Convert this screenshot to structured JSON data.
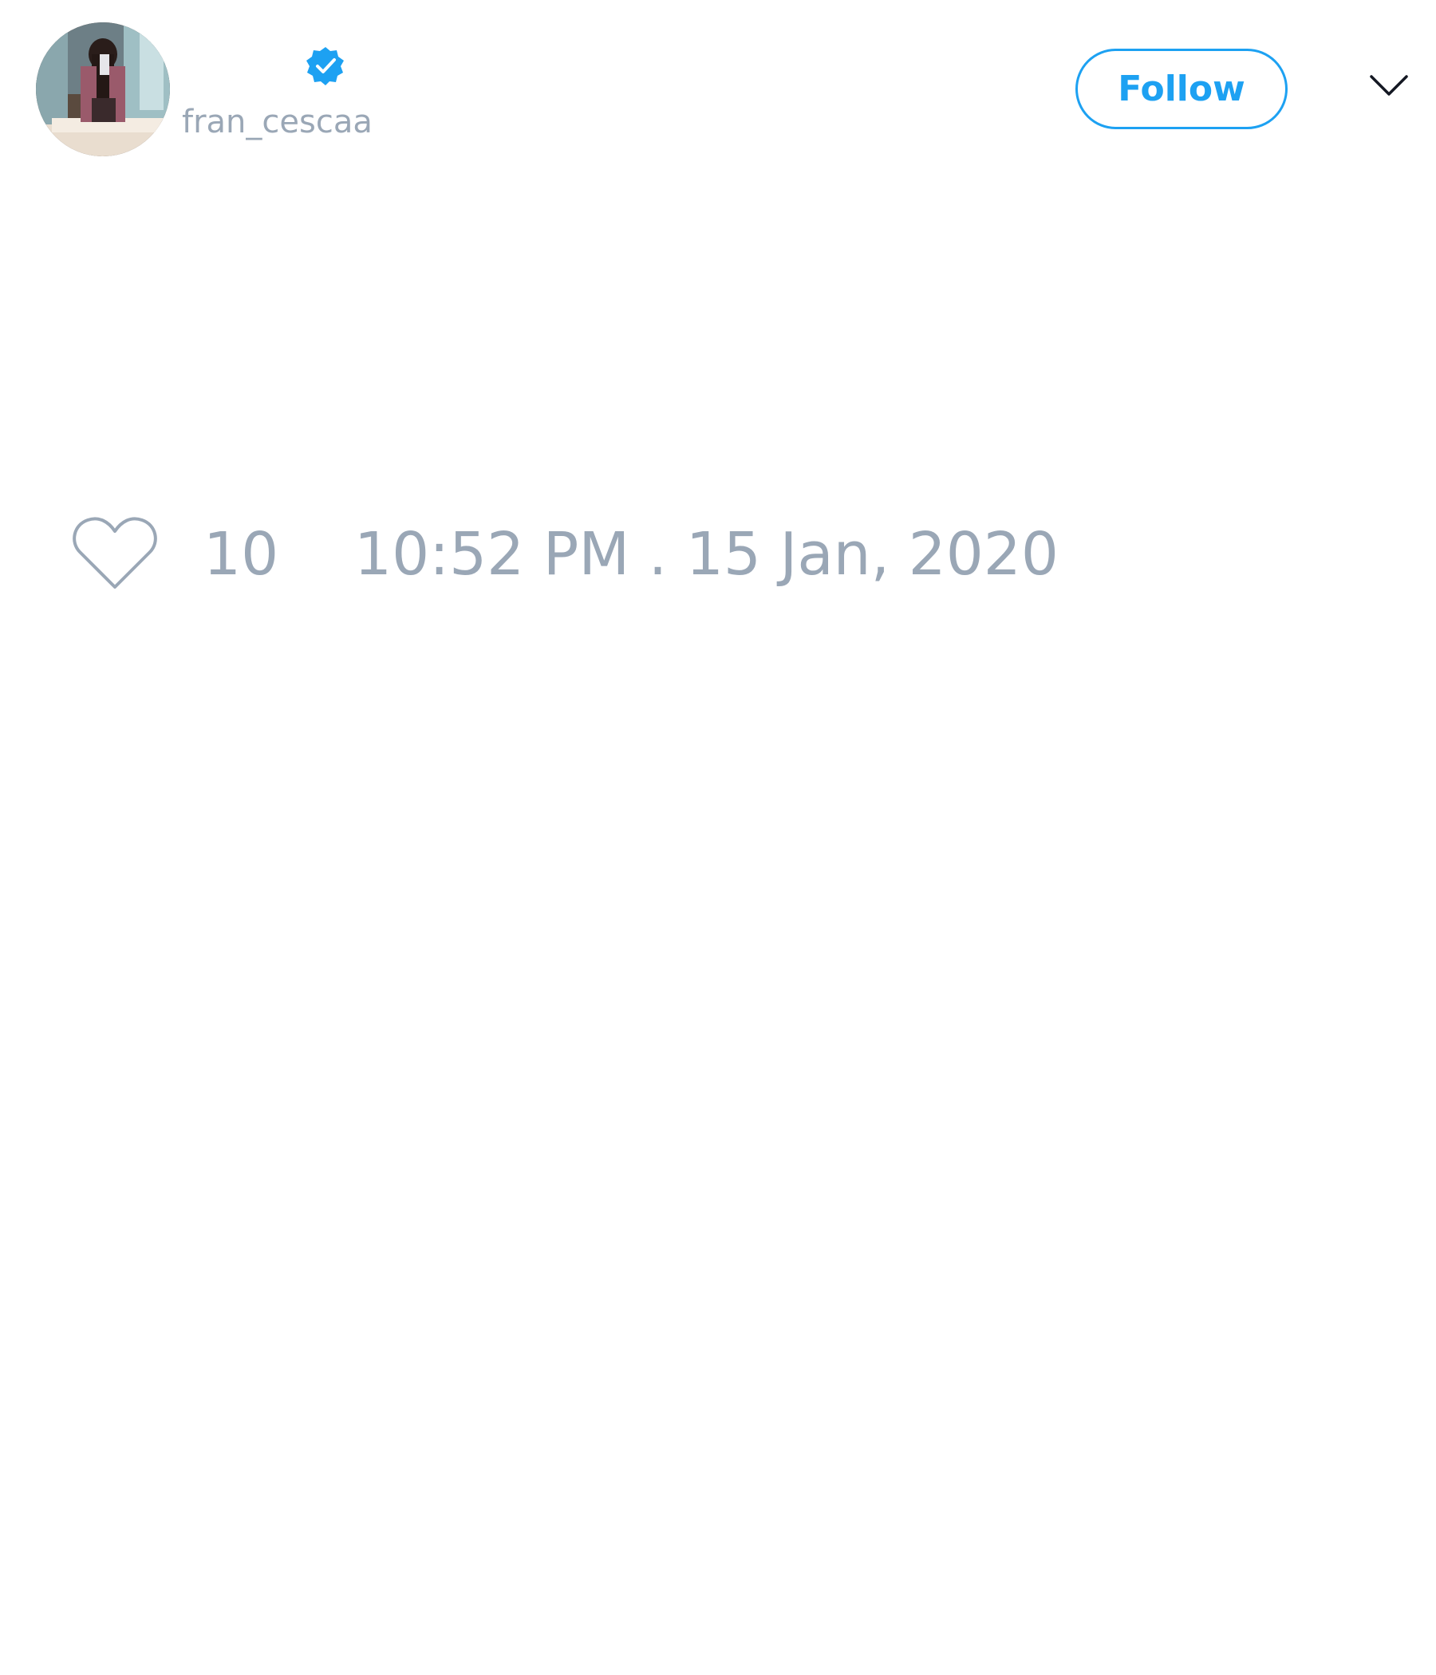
{
  "tweet": {
    "author": {
      "handle": "fran_cescaa",
      "verified": true,
      "avatar": "profile-photo"
    },
    "follow_label": "Follow",
    "likes": "10",
    "timestamp": "10:52 PM . 15 Jan, 2020"
  },
  "icons": {
    "verified": "verified-badge-icon",
    "menu": "chevron-down-icon",
    "like": "heart-icon"
  },
  "colors": {
    "accent": "#1da1f2",
    "muted_text": "#9aa7b6",
    "background": "#ffffff"
  }
}
